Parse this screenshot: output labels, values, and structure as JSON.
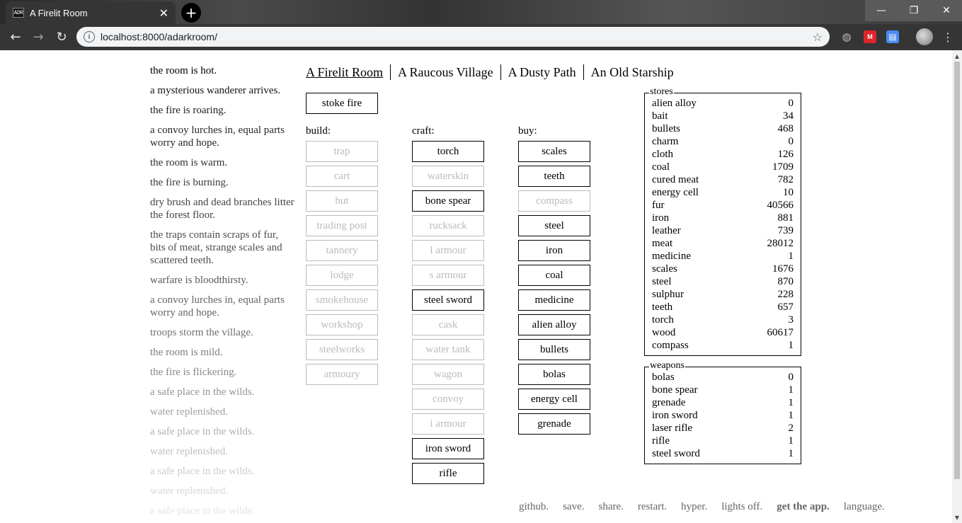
{
  "browser": {
    "tab_title": "A Firelit Room",
    "favicon_text": "ADR",
    "url": "localhost:8000/adarkroom/"
  },
  "header": {
    "locations": [
      {
        "label": "A Firelit Room",
        "selected": true
      },
      {
        "label": "A Raucous Village",
        "selected": false
      },
      {
        "label": "A Dusty Path",
        "selected": false
      },
      {
        "label": "An Old Starship",
        "selected": false
      }
    ]
  },
  "notifications": [
    {
      "text": "the room is hot.",
      "shade": "#000000"
    },
    {
      "text": "a mysterious wanderer arrives.",
      "shade": "#141414"
    },
    {
      "text": "the fire is roaring.",
      "shade": "#1e1e1e"
    },
    {
      "text": "a convoy lurches in, equal parts worry and hope.",
      "shade": "#282828"
    },
    {
      "text": "the room is warm.",
      "shade": "#323232"
    },
    {
      "text": "the fire is burning.",
      "shade": "#3a3a3a"
    },
    {
      "text": "dry brush and dead branches litter the forest floor.",
      "shade": "#444444"
    },
    {
      "text": "the traps contain scraps of fur, bits of meat, strange scales and scattered teeth.",
      "shade": "#4e4e4e"
    },
    {
      "text": "warfare is bloodthirsty.",
      "shade": "#5a5a5a"
    },
    {
      "text": "a convoy lurches in, equal parts worry and hope.",
      "shade": "#646464"
    },
    {
      "text": "troops storm the village.",
      "shade": "#707070"
    },
    {
      "text": "the room is mild.",
      "shade": "#7c7c7c"
    },
    {
      "text": "the fire is flickering.",
      "shade": "#888888"
    },
    {
      "text": "a safe place in the wilds.",
      "shade": "#949494"
    },
    {
      "text": "water replenished.",
      "shade": "#a2a2a2"
    },
    {
      "text": "a safe place in the wilds.",
      "shade": "#b0b0b0"
    },
    {
      "text": "water replenished.",
      "shade": "#bebebe"
    },
    {
      "text": "a safe place in the wilds.",
      "shade": "#cccccc"
    },
    {
      "text": "water replenished.",
      "shade": "#d8d8d8"
    },
    {
      "text": "a safe place in the wilds.",
      "shade": "#e4e4e4"
    }
  ],
  "stoke_fire": "stoke fire",
  "build": {
    "label": "build:",
    "items": [
      {
        "label": "trap",
        "enabled": false
      },
      {
        "label": "cart",
        "enabled": false
      },
      {
        "label": "hut",
        "enabled": false
      },
      {
        "label": "trading post",
        "enabled": false
      },
      {
        "label": "tannery",
        "enabled": false
      },
      {
        "label": "lodge",
        "enabled": false
      },
      {
        "label": "smokehouse",
        "enabled": false
      },
      {
        "label": "workshop",
        "enabled": false
      },
      {
        "label": "steelworks",
        "enabled": false
      },
      {
        "label": "armoury",
        "enabled": false
      }
    ]
  },
  "craft": {
    "label": "craft:",
    "items": [
      {
        "label": "torch",
        "enabled": true
      },
      {
        "label": "waterskin",
        "enabled": false
      },
      {
        "label": "bone spear",
        "enabled": true
      },
      {
        "label": "rucksack",
        "enabled": false
      },
      {
        "label": "l armour",
        "enabled": false
      },
      {
        "label": "s armour",
        "enabled": false
      },
      {
        "label": "steel sword",
        "enabled": true
      },
      {
        "label": "cask",
        "enabled": false
      },
      {
        "label": "water tank",
        "enabled": false
      },
      {
        "label": "wagon",
        "enabled": false
      },
      {
        "label": "convoy",
        "enabled": false
      },
      {
        "label": "i armour",
        "enabled": false
      },
      {
        "label": "iron sword",
        "enabled": true
      },
      {
        "label": "rifle",
        "enabled": true
      }
    ]
  },
  "buy": {
    "label": "buy:",
    "items": [
      {
        "label": "scales",
        "enabled": true
      },
      {
        "label": "teeth",
        "enabled": true
      },
      {
        "label": "compass",
        "enabled": false
      },
      {
        "label": "steel",
        "enabled": true
      },
      {
        "label": "iron",
        "enabled": true
      },
      {
        "label": "coal",
        "enabled": true
      },
      {
        "label": "medicine",
        "enabled": true
      },
      {
        "label": "alien alloy",
        "enabled": true
      },
      {
        "label": "bullets",
        "enabled": true
      },
      {
        "label": "bolas",
        "enabled": true
      },
      {
        "label": "energy cell",
        "enabled": true
      },
      {
        "label": "grenade",
        "enabled": true
      }
    ]
  },
  "stores": {
    "legend": "stores",
    "rows": [
      {
        "name": "alien alloy",
        "value": "0"
      },
      {
        "name": "bait",
        "value": "34"
      },
      {
        "name": "bullets",
        "value": "468"
      },
      {
        "name": "charm",
        "value": "0"
      },
      {
        "name": "cloth",
        "value": "126"
      },
      {
        "name": "coal",
        "value": "1709"
      },
      {
        "name": "cured meat",
        "value": "782"
      },
      {
        "name": "energy cell",
        "value": "10"
      },
      {
        "name": "fur",
        "value": "40566"
      },
      {
        "name": "iron",
        "value": "881"
      },
      {
        "name": "leather",
        "value": "739"
      },
      {
        "name": "meat",
        "value": "28012"
      },
      {
        "name": "medicine",
        "value": "1"
      },
      {
        "name": "scales",
        "value": "1676"
      },
      {
        "name": "steel",
        "value": "870"
      },
      {
        "name": "sulphur",
        "value": "228"
      },
      {
        "name": "teeth",
        "value": "657"
      },
      {
        "name": "torch",
        "value": "3"
      },
      {
        "name": "wood",
        "value": "60617"
      },
      {
        "name": "compass",
        "value": "1"
      }
    ]
  },
  "weapons": {
    "legend": "weapons",
    "rows": [
      {
        "name": "bolas",
        "value": "0"
      },
      {
        "name": "bone spear",
        "value": "1"
      },
      {
        "name": "grenade",
        "value": "1"
      },
      {
        "name": "iron sword",
        "value": "1"
      },
      {
        "name": "laser rifle",
        "value": "2"
      },
      {
        "name": "rifle",
        "value": "1"
      },
      {
        "name": "steel sword",
        "value": "1"
      }
    ]
  },
  "footer": [
    {
      "label": "github.",
      "bold": false
    },
    {
      "label": "save.",
      "bold": false
    },
    {
      "label": "share.",
      "bold": false
    },
    {
      "label": "restart.",
      "bold": false
    },
    {
      "label": "hyper.",
      "bold": false
    },
    {
      "label": "lights off.",
      "bold": false
    },
    {
      "label": "get the app.",
      "bold": true
    },
    {
      "label": "language.",
      "bold": false
    }
  ]
}
